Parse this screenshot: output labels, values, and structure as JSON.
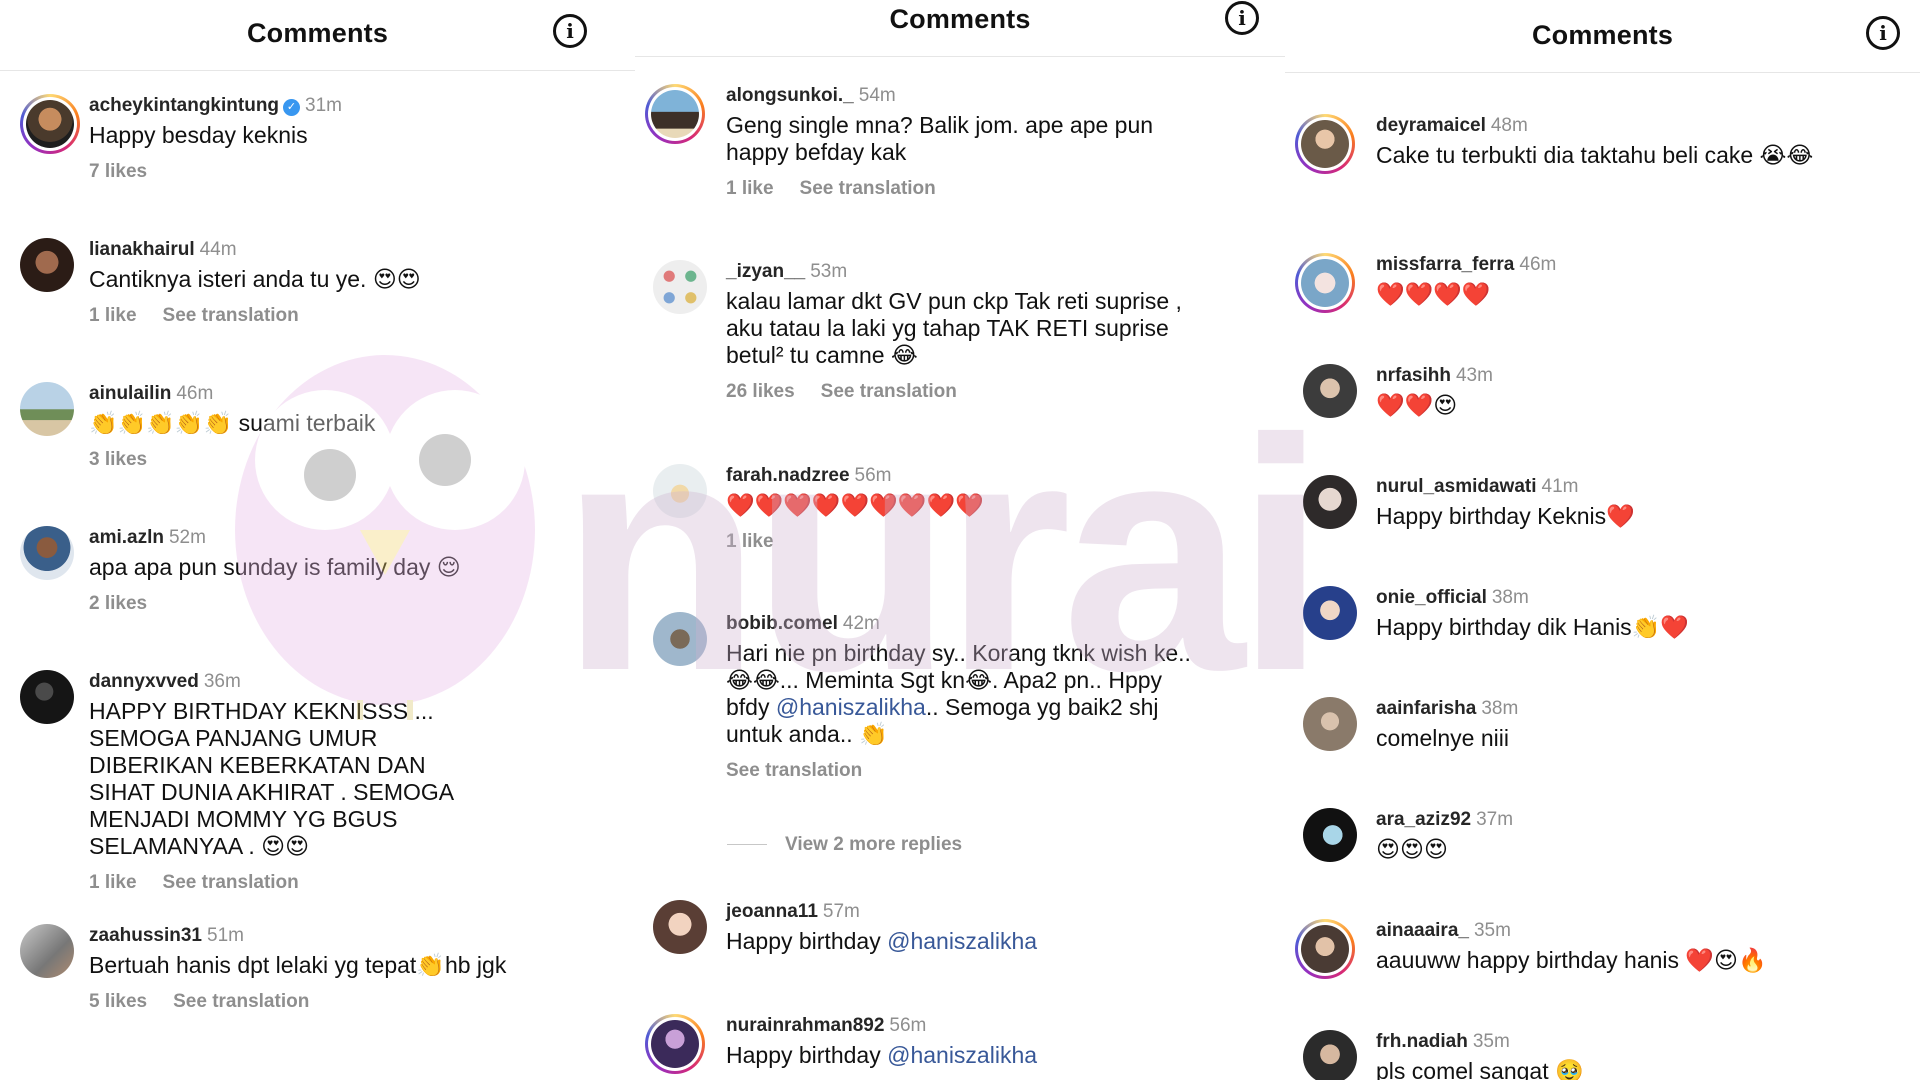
{
  "panels": [
    {
      "title": "Comments",
      "comments": [
        {
          "user": "acheykintangkintung",
          "verified": true,
          "time": "31m",
          "text": "Happy besday keknis",
          "likes": "7 likes",
          "translation": ""
        },
        {
          "user": "lianakhairul",
          "time": "44m",
          "text": "Cantiknya isteri anda tu ye. 😍😍",
          "likes": "1 like",
          "translation": "See translation"
        },
        {
          "user": "ainulailin",
          "time": "46m",
          "text": "👏👏👏👏👏 suami terbaik",
          "likes": "3 likes",
          "translation": ""
        },
        {
          "user": "ami.azln",
          "time": "52m",
          "text": "apa apa pun sunday is family day 😌",
          "likes": "2 likes",
          "translation": ""
        },
        {
          "user": "dannyxvved",
          "time": "36m",
          "text": "HAPPY BIRTHDAY KEKNISSS ... SEMOGA PANJANG UMUR DIBERIKAN KEBERKATAN DAN SIHAT DUNIA AKHIRAT . SEMOGA MENJADI MOMMY YG BGUS SELAMANYAA . 😍😍",
          "likes": "1 like",
          "translation": "See translation"
        },
        {
          "user": "zaahussin31",
          "time": "51m",
          "text": "Bertuah hanis dpt lelaki yg tepat👏hb jgk",
          "likes": "5 likes",
          "translation": "See translation"
        }
      ]
    },
    {
      "title": "Comments",
      "comments": [
        {
          "user": "alongsunkoi._",
          "time": "54m",
          "text": "Geng single mna? Balik jom. ape ape pun happy befday kak",
          "likes": "1 like",
          "translation": "See translation"
        },
        {
          "user": "_izyan__",
          "time": "53m",
          "text": "kalau lamar dkt GV pun ckp Tak reti suprise , aku tatau la laki yg tahap TAK RETI suprise betul² tu camne 😂",
          "likes": "26 likes",
          "translation": "See translation"
        },
        {
          "user": "farah.nadzree",
          "time": "56m",
          "text": "❤️❤️❤️❤️❤️❤️❤️❤️❤️",
          "likes": "1 like",
          "translation": ""
        },
        {
          "user": "bobib.comel",
          "time": "42m",
          "text_before": "Hari nie pn birthday sy.. Korang tknk wish ke.. 😂😂... Meminta Sgt kn😂. Apa2 pn.. Hppy bfdy ",
          "mention": "@haniszalikha",
          "text_after": ".. Semoga yg baik2 shj untuk anda.. 👏",
          "likes": "",
          "translation": "See translation"
        },
        {
          "user": "jeoanna11",
          "time": "57m",
          "text_before": "Happy birthday ",
          "mention": "@haniszalikha",
          "text_after": "",
          "likes": "",
          "translation": ""
        },
        {
          "user": "nurainrahman892",
          "time": "56m",
          "text_before": "Happy birthday ",
          "mention": "@haniszalikha",
          "text_after": "",
          "likes": "",
          "translation": ""
        }
      ],
      "more_replies": "View 2 more replies"
    },
    {
      "title": "Comments",
      "comments": [
        {
          "user": "deyramaicel",
          "time": "48m",
          "text": "Cake tu terbukti dia taktahu beli cake 😭😂"
        },
        {
          "user": "missfarra_ferra",
          "time": "46m",
          "text": "❤️❤️❤️❤️"
        },
        {
          "user": "nrfasihh",
          "time": "43m",
          "text": "❤️❤️😍"
        },
        {
          "user": "nurul_asmidawati",
          "time": "41m",
          "text": "Happy birthday Keknis❤️"
        },
        {
          "user": "onie_official",
          "time": "38m",
          "text": "Happy birthday dik Hanis👏❤️"
        },
        {
          "user": "aainfarisha",
          "time": "38m",
          "text": "comelnye niii"
        },
        {
          "user": "ara_aziz92",
          "time": "37m",
          "text": "😍😍😍"
        },
        {
          "user": "ainaaaira_",
          "time": "35m",
          "text": "aauuww happy birthday hanis ❤️😍🔥"
        },
        {
          "user": "frh.nadiah",
          "time": "35m",
          "text": "pls comel sangat 🥹"
        }
      ]
    }
  ],
  "icons": {
    "info": "info-icon",
    "verified": "verified-badge-icon"
  },
  "watermark": "nurai",
  "colors": {
    "username": "#262626",
    "meta": "#8e8e8e",
    "mention": "#385898",
    "watermark": "#cfb4d0"
  }
}
